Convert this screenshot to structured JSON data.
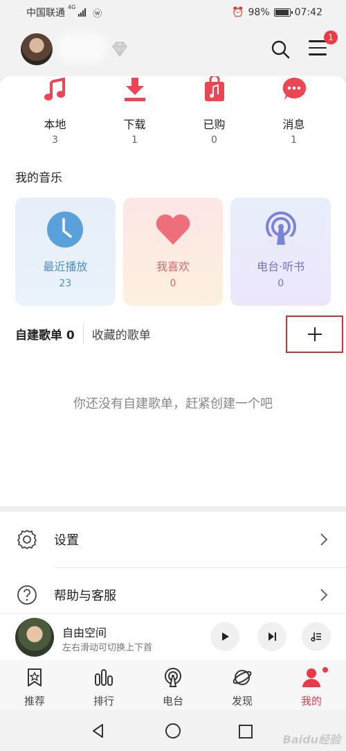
{
  "status": {
    "carrier": "中国联通",
    "network": "4G",
    "battery": "98%",
    "time": "07:42"
  },
  "header": {
    "menu_badge": "1"
  },
  "quick": [
    {
      "label": "本地",
      "count": "3",
      "icon": "music-note-icon"
    },
    {
      "label": "下载",
      "count": "1",
      "icon": "download-icon"
    },
    {
      "label": "已购",
      "count": "0",
      "icon": "purchased-bag-icon"
    },
    {
      "label": "消息",
      "count": "1",
      "icon": "message-bubble-icon"
    }
  ],
  "my_music": {
    "title": "我的音乐",
    "cards": [
      {
        "label": "最近播放",
        "count": "23",
        "icon": "clock-icon"
      },
      {
        "label": "我喜欢",
        "count": "0",
        "icon": "heart-icon"
      },
      {
        "label": "电台·听书",
        "count": "0",
        "icon": "radio-icon"
      }
    ]
  },
  "playlists": {
    "own_tab": "自建歌单 0",
    "fav_tab": "收藏的歌单",
    "empty_text": "你还没有自建歌单，赶紧创建一个吧"
  },
  "settings": [
    {
      "label": "设置",
      "icon": "gear-icon"
    },
    {
      "label": "帮助与客服",
      "icon": "help-icon"
    }
  ],
  "player": {
    "title": "自由空间",
    "subtitle": "左右滑动可切换上下首"
  },
  "nav": [
    {
      "label": "推荐",
      "icon": "star-bookmark-icon"
    },
    {
      "label": "排行",
      "icon": "chart-bars-icon"
    },
    {
      "label": "电台",
      "icon": "radio-icon"
    },
    {
      "label": "发现",
      "icon": "planet-icon"
    },
    {
      "label": "我的",
      "icon": "user-icon"
    }
  ],
  "watermark": "Baidu经验",
  "colors": {
    "accent": "#e83a4a",
    "highlight_box": "#d0302f"
  }
}
